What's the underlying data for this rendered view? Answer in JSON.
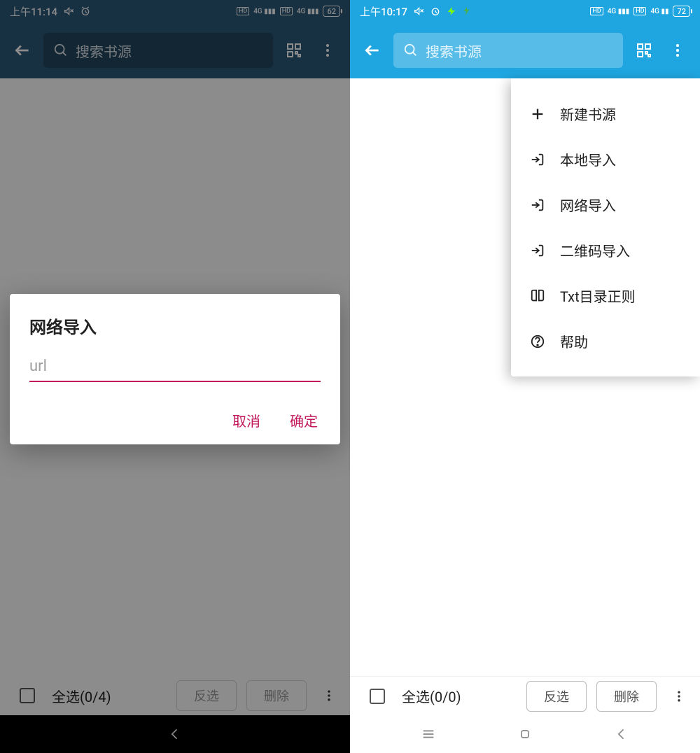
{
  "left": {
    "status": {
      "time": "上午11:14",
      "battery": "62"
    },
    "topbar": {
      "search_placeholder": "搜索书源"
    },
    "dialog": {
      "title": "网络导入",
      "placeholder": "url",
      "cancel": "取消",
      "ok": "确定"
    },
    "bottom": {
      "select_all": "全选(0/4)",
      "invert": "反选",
      "delete": "删除"
    }
  },
  "right": {
    "status": {
      "time": "上午10:17",
      "battery": "72"
    },
    "topbar": {
      "search_placeholder": "搜索书源"
    },
    "menu": {
      "items": [
        {
          "label": "新建书源",
          "icon": "plus"
        },
        {
          "label": "本地导入",
          "icon": "import"
        },
        {
          "label": "网络导入",
          "icon": "import"
        },
        {
          "label": "二维码导入",
          "icon": "import"
        },
        {
          "label": "Txt目录正则",
          "icon": "book"
        },
        {
          "label": "帮助",
          "icon": "help"
        }
      ]
    },
    "bottom": {
      "select_all": "全选(0/0)",
      "invert": "反选",
      "delete": "删除"
    }
  }
}
